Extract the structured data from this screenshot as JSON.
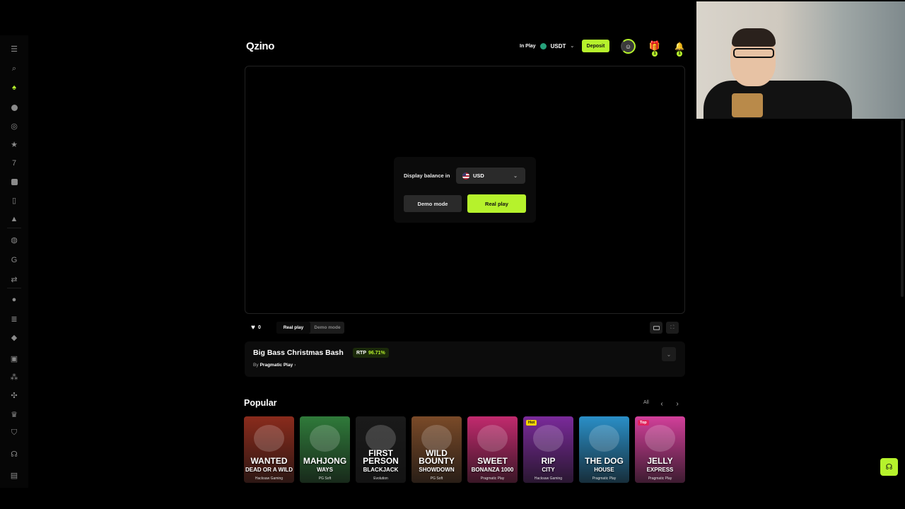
{
  "header": {
    "logo": "Qzino",
    "wallet_status": "In Play",
    "currency": "USDT",
    "deposit_label": "Deposit",
    "gift_count": "1",
    "notification_count": "1"
  },
  "balance_modal": {
    "label": "Display balance in",
    "currency": "USD",
    "demo_label": "Demo mode",
    "real_label": "Real play"
  },
  "controls": {
    "favorites_count": "0",
    "real_play_label": "Real play",
    "demo_mode_label": "Demo mode"
  },
  "game_info": {
    "title": "Big Bass Christmas Bash",
    "rtp_label": "RTP",
    "rtp_value": "96.71%",
    "by_label": "By",
    "provider": "Pragmatic Play"
  },
  "popular": {
    "title": "Popular",
    "all_label": "All",
    "games": [
      {
        "name_line1": "WANTED",
        "name_line2": "DEAD OR A WILD",
        "provider": "Hacksaw Gaming",
        "tag": "",
        "bg": "#8a2b1c"
      },
      {
        "name_line1": "MAHJONG",
        "name_line2": "WAYS",
        "provider": "PG Soft",
        "tag": "",
        "bg": "#2f7a3a"
      },
      {
        "name_line1": "FIRST PERSON",
        "name_line2": "BLACKJACK",
        "provider": "Evolution",
        "tag": "",
        "bg": "#1a1a1a"
      },
      {
        "name_line1": "WILD BOUNTY",
        "name_line2": "SHOWDOWN",
        "provider": "PG Soft",
        "tag": "",
        "bg": "#7a4a28"
      },
      {
        "name_line1": "SWEET",
        "name_line2": "BONANZA 1000",
        "provider": "Pragmatic Play",
        "tag": "",
        "bg": "#c22a6e"
      },
      {
        "name_line1": "RIP",
        "name_line2": "CITY",
        "provider": "Hacksaw Gaming",
        "tag": "Hot",
        "bg": "#7a2a9a"
      },
      {
        "name_line1": "THE DOG",
        "name_line2": "HOUSE",
        "provider": "Pragmatic Play",
        "tag": "",
        "bg": "#2a8fc7"
      },
      {
        "name_line1": "JELLY",
        "name_line2": "EXPRESS",
        "provider": "Pragmatic Play",
        "tag": "Top",
        "bg": "#d23f9a"
      }
    ]
  },
  "colors": {
    "accent": "#b6f22c",
    "background": "#000000",
    "panel": "#0c0c0c"
  },
  "sidebar": {
    "icons": [
      "menu-icon",
      "search-icon",
      "casino-icon",
      "live-icon",
      "target-icon",
      "star-icon",
      "seven-icon",
      "video-icon",
      "cards-icon",
      "rocket-icon",
      "sports-icon",
      "qzino-icon",
      "swap-icon",
      "globe-icon",
      "docs-icon",
      "ticket-icon",
      "gift-icon",
      "group-icon",
      "community-icon",
      "crown-icon",
      "shield-icon",
      "support-icon",
      "clipboard-icon"
    ]
  }
}
